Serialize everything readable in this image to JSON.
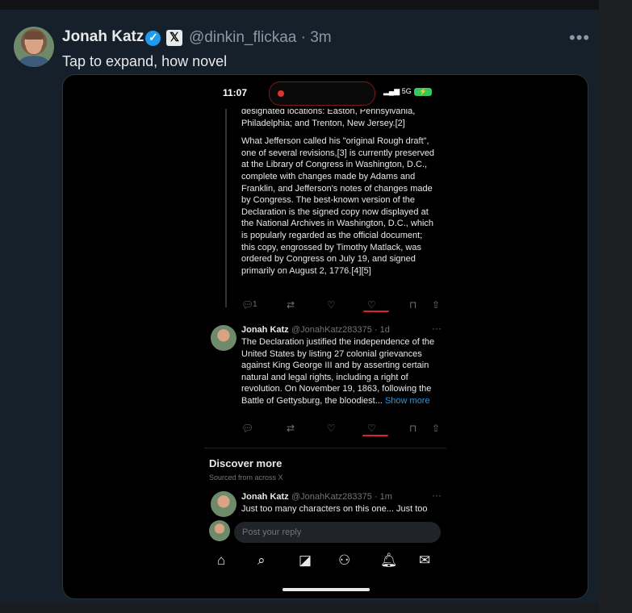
{
  "post": {
    "author_name": "Jonah Katz",
    "handle_time": "@dinkin_flickaa · 3m",
    "text": "Tap to expand, how novel",
    "more": "•••"
  },
  "phone": {
    "time": "11:07",
    "signal": "5G",
    "thread_text_1": "designated locations: Easton, Pennsylvania, Philadelphia; and Trenton, New Jersey.[2]",
    "thread_text_2": "What Jefferson called his \"original Rough draft\", one of several revisions,[3] is currently preserved at the Library of Congress in Washington, D.C., complete with changes made by Adams and Franklin, and Jefferson's notes of changes made by Congress. The best-known version of the Declaration is the signed copy now displayed at the National Archives in Washington, D.C., which is popularly regarded as the official document; this copy, engrossed by Timothy Matlack, was ordered by Congress on July 19, and signed primarily on August 2, 1776.[4][5]",
    "reply_count": "1",
    "tweet2": {
      "name": "Jonah Katz",
      "handle": "@JonahKatz283375 · 1d",
      "text": "The Declaration justified the independence of the United States by listing 27 colonial grievances against King George III and by asserting certain natural and legal rights, including a right of revolution. On November 19, 1863, following the Battle of Gettysburg, the bloodiest...",
      "show_more": "Show more"
    },
    "discover_title": "Discover more",
    "discover_sub": "Sourced from across X",
    "tweet3": {
      "name": "Jonah Katz",
      "handle": "@JonahKatz283375 · 1m",
      "text": "Just too many characters on this one... Just too"
    },
    "reply_placeholder": "Post your reply"
  }
}
